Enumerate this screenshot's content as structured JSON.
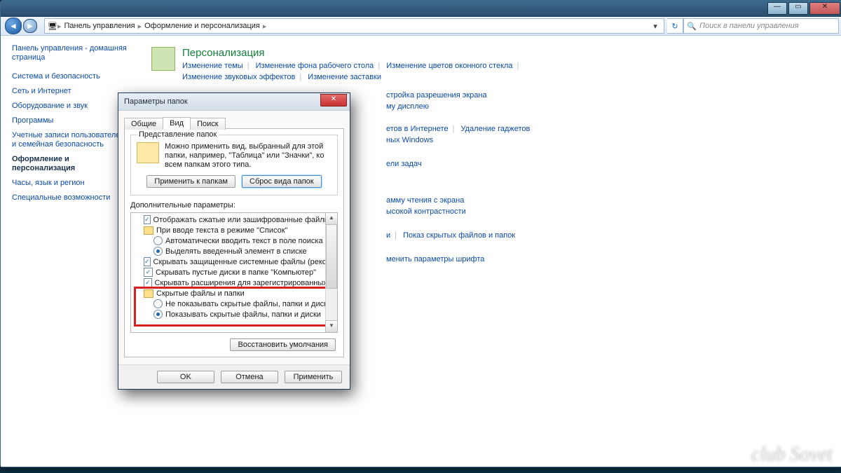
{
  "titlebar": {
    "min": "—",
    "max": "▭",
    "close": "✕"
  },
  "nav": {
    "crumb_root": "Панель управления",
    "crumb_mid": "Оформление и персонализация",
    "refresh": "↻",
    "dropdown": "▾"
  },
  "search": {
    "placeholder": "Поиск в панели управления",
    "icon": "🔍"
  },
  "sidebar": {
    "home": "Панель управления - домашняя страница",
    "items": [
      "Система и безопасность",
      "Сеть и Интернет",
      "Оборудование и звук",
      "Программы",
      "Учетные записи пользователей и семейная безопасность",
      "Оформление и персонализация",
      "Часы, язык и регион",
      "Специальные возможности"
    ]
  },
  "main": {
    "cat_title": "Персонализация",
    "links1": [
      "Изменение темы",
      "Изменение фона рабочего стола",
      "Изменение цветов оконного стекла"
    ],
    "links2": [
      "Изменение звуковых эффектов",
      "Изменение заставки"
    ],
    "partial1": "стройка разрешения экрана",
    "partial2": "му дисплею",
    "partial3": "етов в Интернете",
    "partial4": "Удаление гаджетов",
    "partial5": "ных Windows",
    "partial6": "ели задач",
    "partial7": "амму чтения с экрана",
    "partial8": "ысокой контрастности",
    "partial9": "и",
    "partial10": "Показ скрытых файлов и папок",
    "partial11": "менить параметры шрифта"
  },
  "dialog": {
    "title": "Параметры папок",
    "close": "✕",
    "tabs": [
      "Общие",
      "Вид",
      "Поиск"
    ],
    "group_legend": "Представление папок",
    "group_text": "Можно применить вид, выбранный для этой папки, например, \"Таблица\" или \"Значки\", ко всем папкам этого типа.",
    "apply_folders": "Применить к папкам",
    "reset_view": "Сброс вида папок",
    "extra_label": "Дополнительные параметры:",
    "tree": [
      {
        "t": "chk",
        "c": true,
        "i": 1,
        "txt": "Отображать сжатые или зашифрованные файлы NTI"
      },
      {
        "t": "folder",
        "i": 1,
        "txt": "При вводе текста в режиме \"Список\""
      },
      {
        "t": "rdo",
        "c": false,
        "i": 2,
        "txt": "Автоматически вводить текст в поле поиска"
      },
      {
        "t": "rdo",
        "c": true,
        "i": 2,
        "txt": "Выделять введенный элемент в списке"
      },
      {
        "t": "chk",
        "c": true,
        "i": 1,
        "txt": "Скрывать защищенные системные файлы (рекомен."
      },
      {
        "t": "chk",
        "c": true,
        "i": 1,
        "txt": "Скрывать пустые диски в папке \"Компьютер\""
      },
      {
        "t": "chk",
        "c": true,
        "i": 1,
        "txt": "Скрывать расширения для зарегистрированных ти"
      },
      {
        "t": "folder",
        "i": 1,
        "txt": "Скрытые файлы и папки"
      },
      {
        "t": "rdo",
        "c": false,
        "i": 2,
        "txt": "Не показывать скрытые файлы, папки и диски"
      },
      {
        "t": "rdo",
        "c": true,
        "i": 2,
        "txt": "Показывать скрытые файлы, папки и диски"
      }
    ],
    "restore": "Восстановить умолчания",
    "ok": "OK",
    "cancel": "Отмена",
    "apply": "Применить"
  },
  "watermark": "club Sovet"
}
